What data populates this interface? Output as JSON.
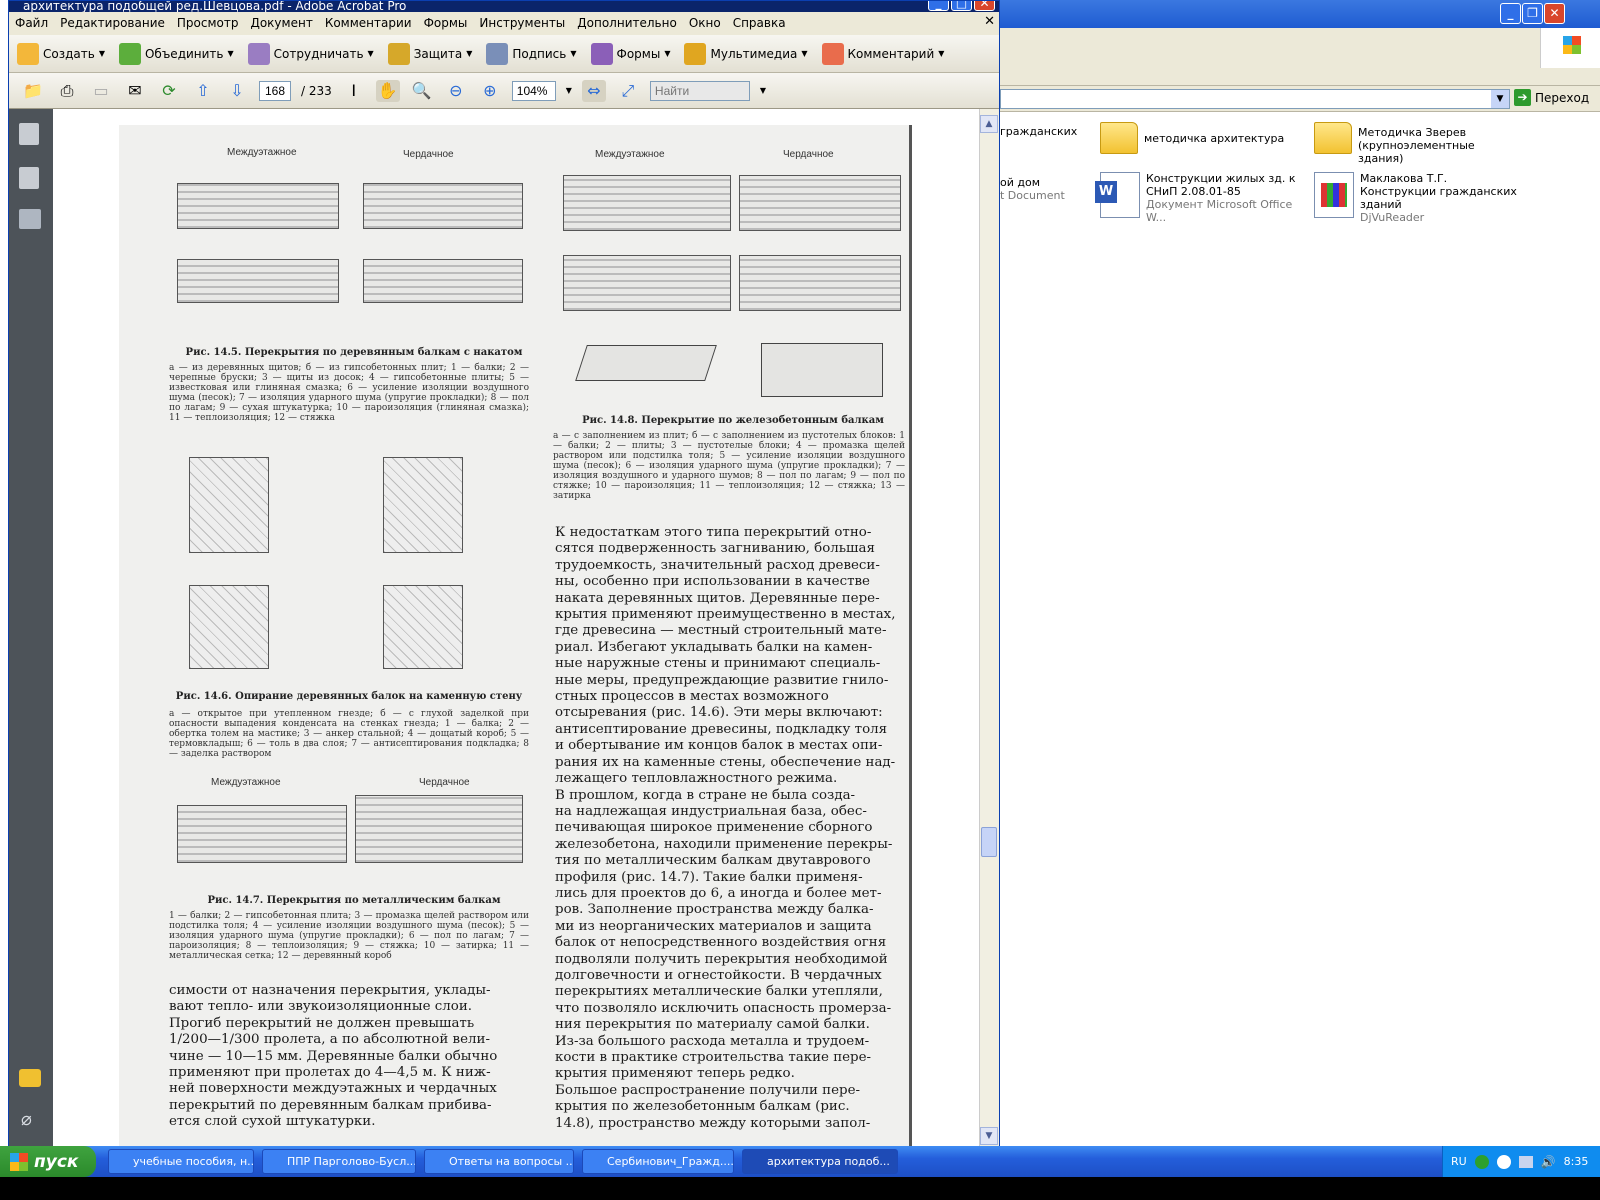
{
  "acrobat": {
    "title": "архитектура подобщей ред.Шевцова.pdf - Adobe Acrobat Pro",
    "menu": [
      "Файл",
      "Редактирование",
      "Просмотр",
      "Документ",
      "Комментарии",
      "Формы",
      "Инструменты",
      "Дополнительно",
      "Окно",
      "Справка"
    ],
    "toolbar": [
      "Создать",
      "Объединить",
      "Сотрудничать",
      "Защита",
      "Подпись",
      "Формы",
      "Мультимедиа",
      "Комментарий"
    ],
    "page_current": "168",
    "page_total": "/ 233",
    "zoom": "104%",
    "find_placeholder": "Найти"
  },
  "explorer": {
    "go_label": "Переход",
    "items": [
      {
        "name": "гражданских"
      },
      {
        "name": "методичка архитектура"
      },
      {
        "name": "Методичка Зверев (крупноэлементные здания)"
      },
      {
        "name": "ой дом",
        "sub": "t Document"
      },
      {
        "name": "Конструкции жилых зд. к СНиП 2.08.01-85",
        "sub": "Документ Microsoft Office W..."
      },
      {
        "name": "Маклакова Т.Г. Конструкции гражданских зданий",
        "sub": "DjVuReader"
      }
    ]
  },
  "page": {
    "fig145_labels": {
      "a": "Междуэтажное",
      "b": "Чердачное"
    },
    "fig145_caption": "Рис. 14.5. Перекрытия по деревянным балкам с накатом",
    "fig145_legend": "а — из деревянных щитов; б — из гипсобетонных плит; 1 — балки; 2 — черепные бруски; 3 — щиты из досок; 4 — гипсобетонные плиты; 5 — известковая или глиняная смазка; 6 — усиление изоляции воздушного шума (песок); 7 — изоляция ударного шума (упругие прокладки); 8 — пол по лагам; 9 — сухая штукатурка; 10 — пароизоляция (глиняная смазка); 11 — теплоизоляция; 12 — стяжка",
    "fig146_caption": "Рис. 14.6. Опирание деревянных балок на каменную стену",
    "fig146_legend": "а — открытое при утепленном гнезде; б — с глухой заделкой при опасности выпадения конденсата на стенках гнезда; 1 — балка; 2 — обертка толем на мастике; 3 — анкер стальной; 4 — дощатый короб; 5 — термовкладыш; 6 — толь в два слоя; 7 — антисептирования подкладка; 8 — заделка раствором",
    "fig147_labels": {
      "a": "Междуэтажное",
      "b": "Чердачное"
    },
    "fig147_caption": "Рис. 14.7. Перекрытия по металлическим балкам",
    "fig147_legend": "1 — балки; 2 — гипсобетонная плита; 3 — промазка щелей раствором или подстилка толя; 4 — усиление изоляции воздушного шума (песок); 5 — изоляция ударного шума (упругие прокладки); 6 — пол по лагам; 7 — пароизоляция; 8 — теплоизоляция; 9 — стяжка; 10 — затирка; 11 — металлическая сетка; 12 — деревянный короб",
    "left_text": "симости от назначения перекрытия, уклады-\nвают тепло- или звукоизоляционные слои.\n    Прогиб перекрытий не должен превышать\n1/200—1/300 пролета, а по абсолютной вели-\nчине — 10—15 мм. Деревянные балки обычно\nприменяют при пролетах до 4—4,5 м. К ниж-\nней поверхности междуэтажных и чердачных\nперекрытий по деревянным балкам прибива-\nется слой сухой штукатурки.",
    "fig148_labels": {
      "a": "Междуэтажное",
      "b": "Чердачное"
    },
    "fig148_caption": "Рис. 14.8. Перекрытие по железобетонным балкам",
    "fig148_legend": "а — с заполнением из плит; б — с заполнением из пустотелых блоков: 1 — балки; 2 — плиты; 3 — пустотелые блоки; 4 — промазка щелей раствором или подстилка толя; 5 — усиление изоляции воздушного шума (песок); 6 — изоляция ударного шума (упругие прокладки); 7 — изоляция воздушного и ударного шумов; 8 — пол по лагам; 9 — пол по стяжке; 10 — пароизоляция; 11 — теплоизоляция; 12 — стяжка; 13 — затирка",
    "right_text": "    К недостаткам этого типа перекрытий отно-\nсятся подверженность загниванию, большая\nтрудоемкость, значительный расход древеси-\nны, особенно при использовании в качестве\nнаката деревянных щитов. Деревянные пере-\nкрытия применяют преимущественно в местах,\nгде древесина — местный строительный мате-\nриал. Избегают укладывать балки на камен-\nные наружные стены и принимают специаль-\nные меры, предупреждающие развитие гнило-\nстных процессов в местах возможного\nотсыревания (рис. 14.6). Эти меры включают:\nантисептирование древесины, подкладку толя\nи обертывание им концов балок в местах опи-\nрания их на каменные стены, обеспечение над-\nлежащего тепловлажностного режима.\n    В прошлом, когда в стране не была созда-\nна надлежащая индустриальная база, обес-\nпечивающая широкое применение сборного\nжелезобетона, находили применение перекры-\nтия по металлическим балкам двутаврового\nпрофиля (рис. 14.7). Такие балки применя-\nлись для проектов до 6, а иногда и более мет-\nров. Заполнение пространства между балка-\nми из неорганических материалов и защита\nбалок от непосредственного воздействия огня\nподволяли получить перекрытия необходимой\nдолговечности и огнестойкости. В чердачных\nперекрытиях металлические балки утепляли,\nчто позволяло исключить опасность промерза-\nния перекрытия по материалу самой балки.\nИз-за большого расхода металла и трудоем-\nкости в практике строительства такие пере-\nкрытия применяют теперь редко.\n    Большое распространение получили пере-\nкрытия по железобетонным балкам (рис.\n14.8), пространство между которыми запол-"
  },
  "taskbar": {
    "start": "пуск",
    "tasks": [
      "учебные пособия, н...",
      "ППР Парголово-Бусл...",
      "Ответы на вопросы ...",
      "Сербинович_Гражд....",
      "архитектура подоб..."
    ],
    "lang": "RU",
    "time": "8:35"
  },
  "colors": {
    "xp_blue": "#245edb",
    "start_green": "#3fa33f",
    "acrobat_title": "#0a246a"
  }
}
